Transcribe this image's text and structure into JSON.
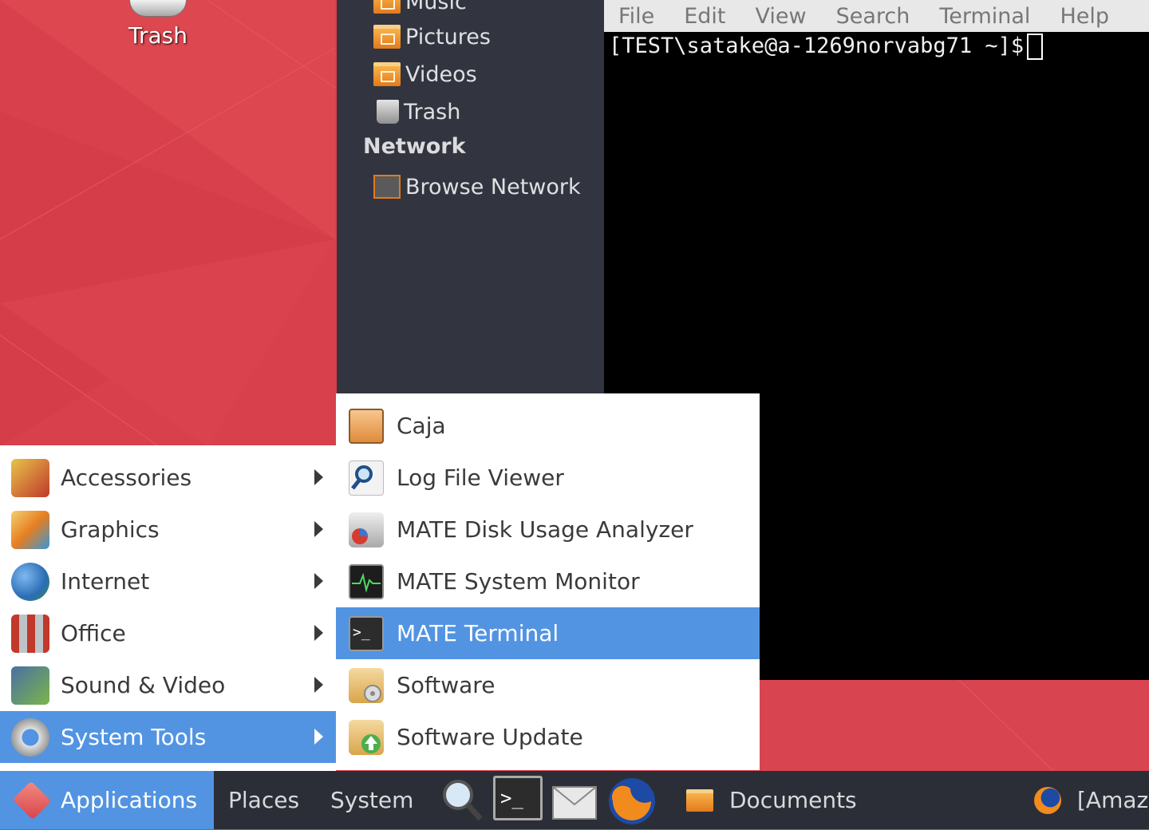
{
  "desktop": {
    "trash_label": "Trash"
  },
  "places_panel": {
    "items": [
      {
        "label": "Music",
        "icon": "folder-music-icon"
      },
      {
        "label": "Pictures",
        "icon": "folder-pictures-icon"
      },
      {
        "label": "Videos",
        "icon": "folder-videos-icon"
      },
      {
        "label": "Trash",
        "icon": "trash-icon"
      }
    ],
    "network_header": "Network",
    "network_items": [
      {
        "label": "Browse Network",
        "icon": "network-icon"
      }
    ]
  },
  "terminal": {
    "menu": [
      "File",
      "Edit",
      "View",
      "Search",
      "Terminal",
      "Help"
    ],
    "prompt": "[TEST\\satake@a-1269norvabg71 ~]$"
  },
  "app_menu": {
    "items": [
      {
        "label": "Accessories",
        "icon": "accessories-icon"
      },
      {
        "label": "Graphics",
        "icon": "graphics-icon"
      },
      {
        "label": "Internet",
        "icon": "globe-icon"
      },
      {
        "label": "Office",
        "icon": "office-icon"
      },
      {
        "label": "Sound & Video",
        "icon": "multimedia-icon"
      },
      {
        "label": "System Tools",
        "icon": "system-tools-gear-icon",
        "selected": true
      }
    ]
  },
  "system_tools_menu": {
    "items": [
      {
        "label": "Caja",
        "icon": "file-cabinet-icon"
      },
      {
        "label": "Log File Viewer",
        "icon": "log-viewer-magnifier-icon"
      },
      {
        "label": "MATE Disk Usage Analyzer",
        "icon": "disk-usage-icon"
      },
      {
        "label": "MATE System Monitor",
        "icon": "system-monitor-icon"
      },
      {
        "label": "MATE Terminal",
        "icon": "terminal-icon",
        "selected": true
      },
      {
        "label": "Software",
        "icon": "software-package-icon"
      },
      {
        "label": "Software Update",
        "icon": "software-update-icon"
      }
    ]
  },
  "taskbar": {
    "applications": "Applications",
    "places": "Places",
    "system": "System",
    "launchers": [
      "search-icon",
      "terminal-icon",
      "mail-icon",
      "firefox-icon"
    ],
    "tasks": [
      {
        "label": "Documents",
        "icon": "folder-icon"
      },
      {
        "label": "[Amaz",
        "icon": "firefox-icon"
      }
    ]
  },
  "colors": {
    "desktop_bg": "#d8404b",
    "selection": "#5294e2",
    "panel_dark": "#323540",
    "taskbar": "#2b2e37"
  }
}
